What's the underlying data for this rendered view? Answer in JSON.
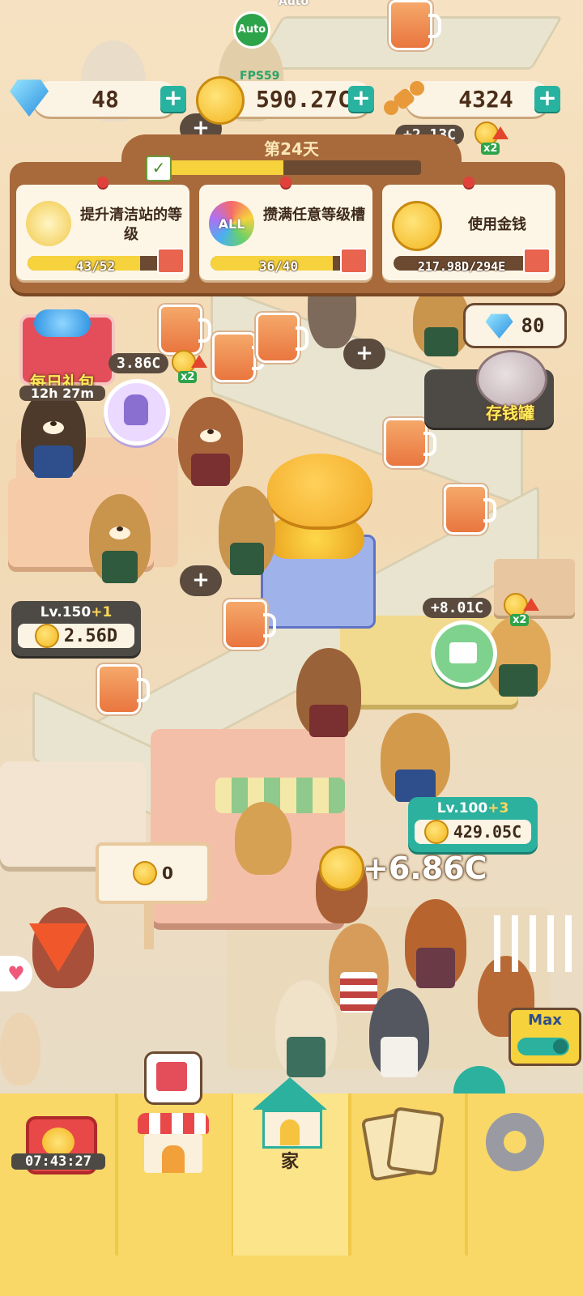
{
  "top": {
    "gems": "48",
    "coins": "590.27C",
    "bones": "4324",
    "fps_label": "FPS59",
    "auto_label": "Auto",
    "bone_rate": "+2.13C",
    "bone_multiplier": "x2"
  },
  "day": {
    "label": "第24天",
    "progress": 0.47
  },
  "quests": [
    {
      "title": "提升清洁站的等级",
      "progress_text": "43/52",
      "progress": 0.83
    },
    {
      "title": "攒满任意等级槽",
      "progress_text": "36/40",
      "progress": 0.9,
      "badge": "ALL"
    },
    {
      "title": "使用金钱",
      "progress_text": "217.98D/294E",
      "progress": 0.0
    }
  ],
  "side": {
    "daily_gift": "每日礼包",
    "daily_gift_timer": "12h 27m",
    "piggy_gems": "80",
    "piggy_label": "存钱罐"
  },
  "stations": [
    {
      "lv_prefix": "Lv.150",
      "lv_plus": "+1",
      "value": "2.56D"
    },
    {
      "lv_prefix": "Lv.100",
      "lv_plus": "+3",
      "value": "429.05C"
    }
  ],
  "floating": {
    "rate_left": "3.86C",
    "rate_left_mult": "x2",
    "rate_right": "+8.01C",
    "rate_right_mult": "x2",
    "income": "+6.86C",
    "small_sign": "0"
  },
  "max_toggle": "Max",
  "nav": {
    "timer": "07:43:27",
    "home_label": "家"
  }
}
